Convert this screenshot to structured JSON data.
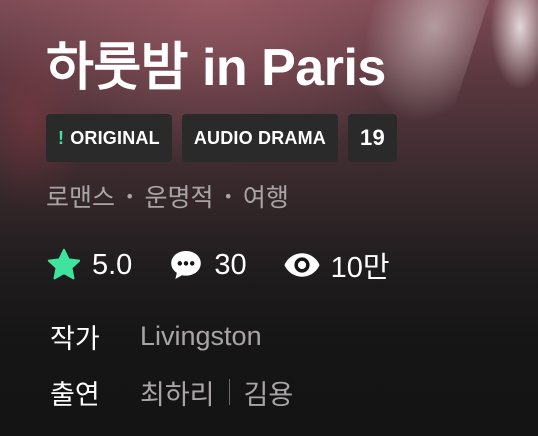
{
  "header": {
    "title": "하룻밤 in Paris"
  },
  "badges": {
    "original_mark": "!",
    "original_label": "ORIGINAL",
    "type_label": "AUDIO DRAMA",
    "age_rating": "19"
  },
  "genres": [
    "로맨스",
    "운명적",
    "여행"
  ],
  "genre_separator": "•",
  "stats": {
    "rating": "5.0",
    "comments": "30",
    "views": "10만",
    "rating_icon": "star-icon",
    "comments_icon": "chat-bubble-icon",
    "views_icon": "eye-icon",
    "accent_color": "#3ee39d"
  },
  "credits": {
    "author_key": "작가",
    "author_value": "Livingston",
    "cast_key": "출연",
    "cast_values": [
      "최하리",
      "김용"
    ]
  }
}
